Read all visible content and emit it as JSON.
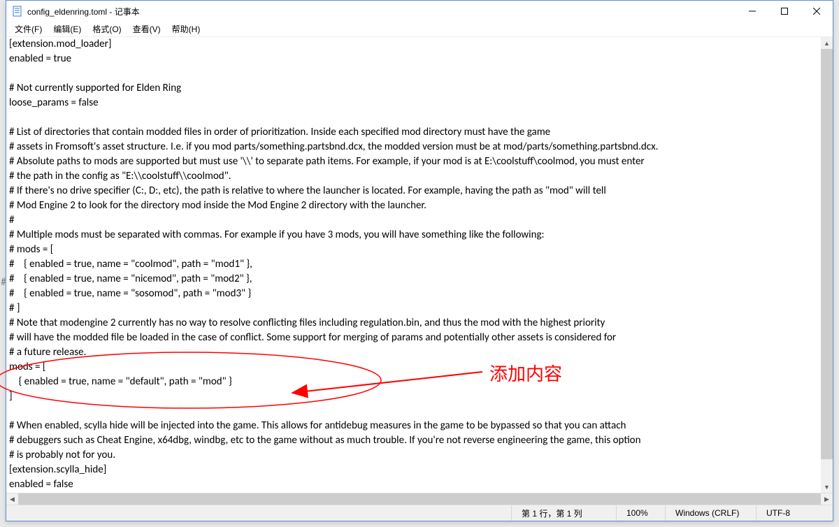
{
  "window": {
    "title": "config_eldenring.toml - 记事本"
  },
  "menu": {
    "file": "文件(F)",
    "edit": "编辑(E)",
    "format": "格式(O)",
    "view": "查看(V)",
    "help": "帮助(H)"
  },
  "editor": {
    "text": "[extension.mod_loader]\nenabled = true\n\n# Not currently supported for Elden Ring\nloose_params = false\n\n# List of directories that contain modded files in order of prioritization. Inside each specified mod directory must have the game\n# assets in Fromsoft's asset structure. I.e. if you mod parts/something.partsbnd.dcx, the modded version must be at mod/parts/something.partsbnd.dcx.\n# Absolute paths to mods are supported but must use '\\\\' to separate path items. For example, if your mod is at E:\\coolstuff\\coolmod, you must enter\n# the path in the config as \"E:\\\\coolstuff\\\\coolmod\".\n# If there's no drive specifier (C:, D:, etc), the path is relative to where the launcher is located. For example, having the path as \"mod\" will tell\n# Mod Engine 2 to look for the directory mod inside the Mod Engine 2 directory with the launcher.\n#\n# Multiple mods must be separated with commas. For example if you have 3 mods, you will have something like the following:\n# mods = [\n#    { enabled = true, name = \"coolmod\", path = \"mod1\" },\n#    { enabled = true, name = \"nicemod\", path = \"mod2\" },\n#    { enabled = true, name = \"sosomod\", path = \"mod3\" }\n# ]\n# Note that modengine 2 currently has no way to resolve conflicting files including regulation.bin, and thus the mod with the highest priority\n# will have the modded file be loaded in the case of conflict. Some support for merging of params and potentially other assets is considered for\n# a future release.\nmods = [\n    { enabled = true, name = \"default\", path = \"mod\" }\n]\n\n# When enabled, scylla hide will be injected into the game. This allows for antidebug measures in the game to be bypassed so that you can attach\n# debuggers such as Cheat Engine, x64dbg, windbg, etc to the game without as much trouble. If you're not reverse engineering the game, this option\n# is probably not for you.\n[extension.scylla_hide]\nenabled = false"
  },
  "annotation": {
    "label": "添加内容"
  },
  "sideLabel": "((#",
  "status": {
    "pos": "第 1 行，第 1 列",
    "zoom": "100%",
    "lineend": "Windows (CRLF)",
    "encoding": "UTF-8"
  }
}
